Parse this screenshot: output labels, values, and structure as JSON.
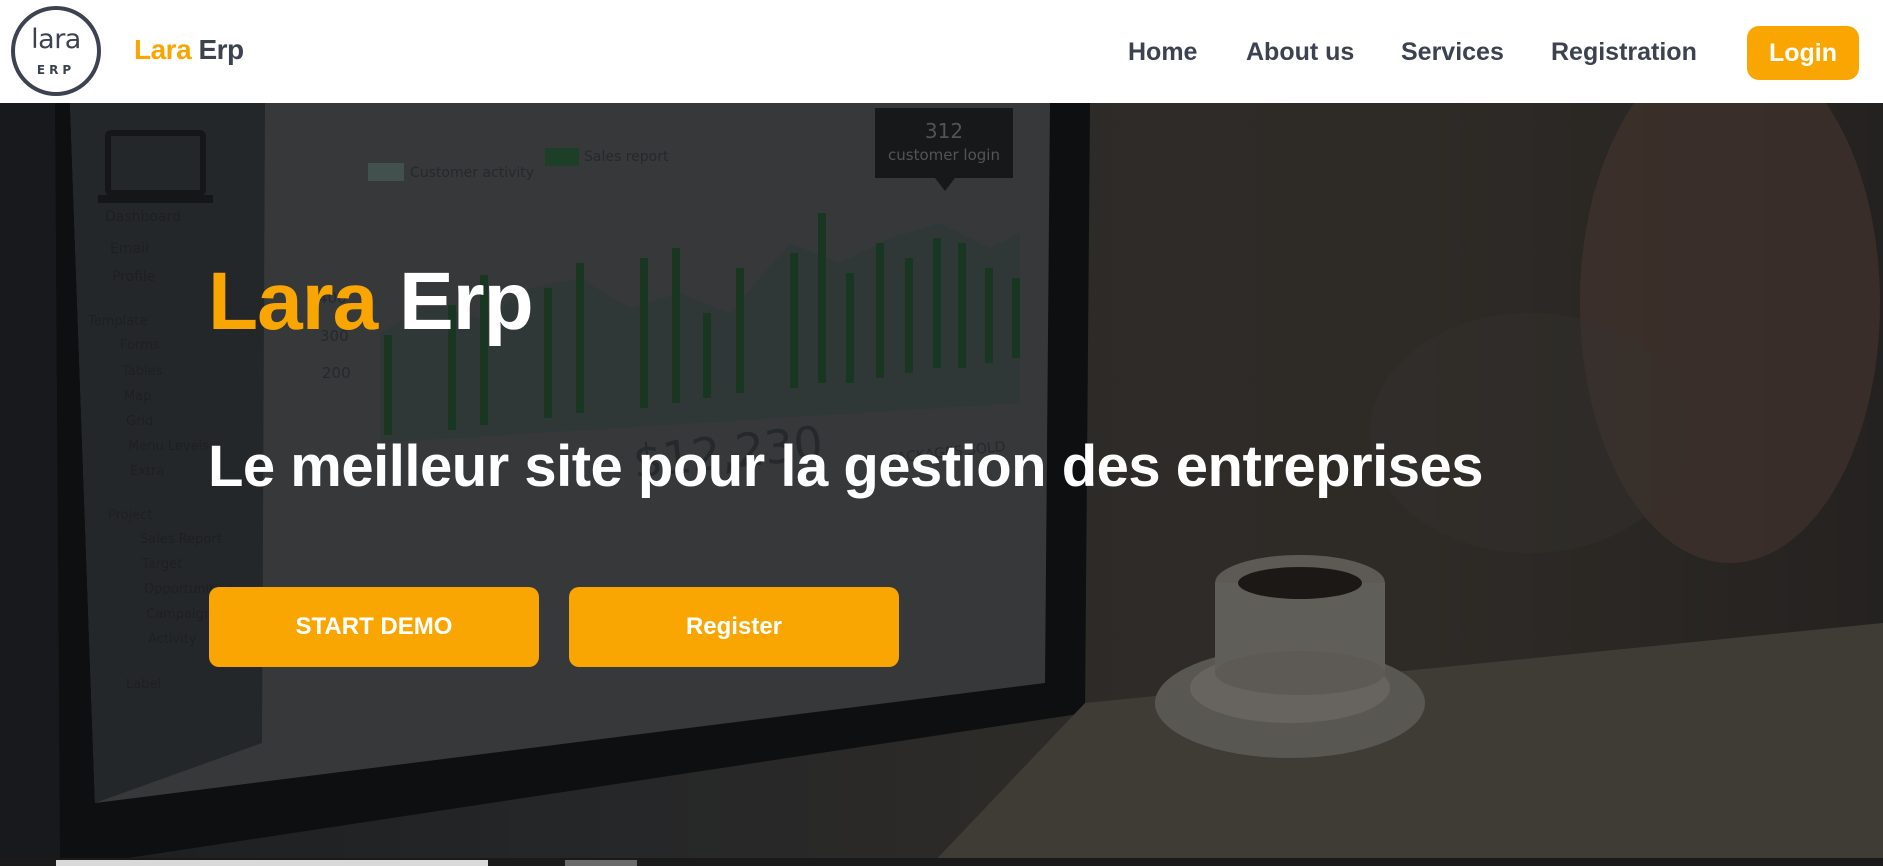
{
  "header": {
    "logo": {
      "word": "lara",
      "sub": "ERP"
    },
    "brand": {
      "part1": "Lara",
      "part2": "Erp"
    },
    "nav": [
      {
        "label": "Home"
      },
      {
        "label": "About us"
      },
      {
        "label": "Services"
      },
      {
        "label": "Registration"
      }
    ],
    "login_label": "Login"
  },
  "hero": {
    "title_part1": "Lara",
    "title_part2": "Erp",
    "subtitle": "Le meilleur site pour la gestion des entreprises",
    "buttons": {
      "start_demo": "START DEMO",
      "register": "Register"
    },
    "background_text": {
      "login_count": "312",
      "login_label": "customer login",
      "legend_customer": "Customer activity",
      "legend_sales": "Sales report",
      "menu": [
        "Dashboard",
        "Email",
        "Profile",
        "Template",
        "Forms",
        "Tables",
        "Map",
        "Grid",
        "Menu Levels",
        "Extra",
        "Project",
        "Sales Report",
        "Target",
        "Opportunities",
        "Campaigns",
        "Activity",
        "Label"
      ],
      "axis": [
        "400",
        "300",
        "200"
      ],
      "stat_value": "$12,230",
      "stat_label": "PACKAGES SOLD"
    }
  },
  "colors": {
    "accent": "#f9a502",
    "dark_text": "#3c4250",
    "white": "#ffffff"
  }
}
